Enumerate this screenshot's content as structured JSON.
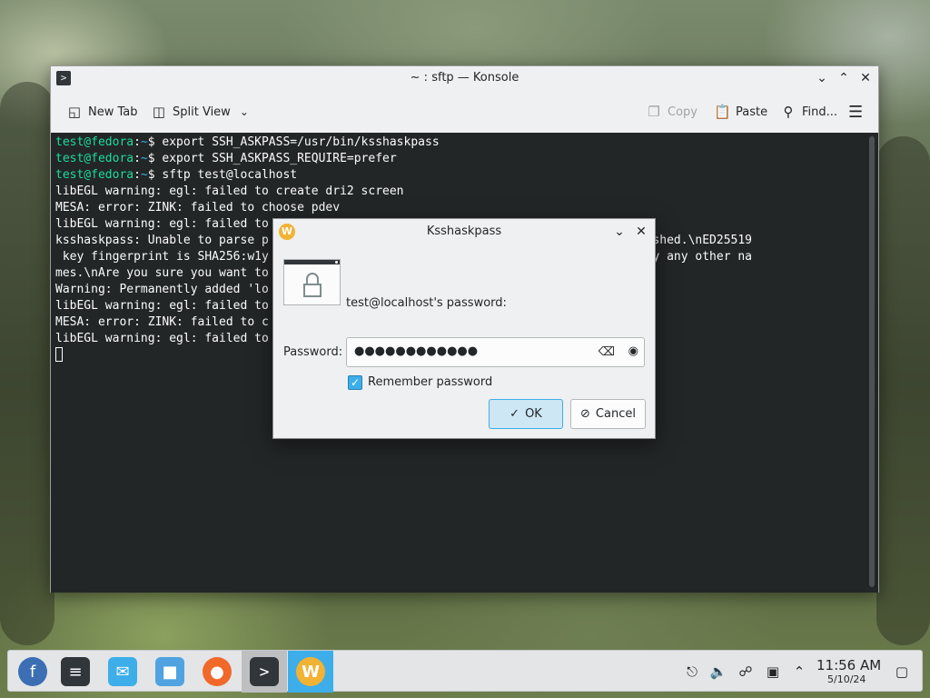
{
  "konsole": {
    "title": "~ : sftp — Konsole",
    "toolbar": {
      "new_tab": "New Tab",
      "split_view": "Split View",
      "copy": "Copy",
      "paste": "Paste",
      "find": "Find..."
    },
    "terminal_lines": [
      {
        "user": "test@fedora",
        "path": "~",
        "cmd": "$ export SSH_ASKPASS=/usr/bin/ksshaskpass"
      },
      {
        "user": "test@fedora",
        "path": "~",
        "cmd": "$ export SSH_ASKPASS_REQUIRE=prefer"
      },
      {
        "user": "test@fedora",
        "path": "~",
        "cmd": "$ sftp test@localhost"
      },
      {
        "text": "libEGL warning: egl: failed to create dri2 screen"
      },
      {
        "text": "MESA: error: ZINK: failed to choose pdev"
      },
      {
        "text": "libEGL warning: egl: failed to"
      },
      {
        "text": "ksshaskpass: Unable to parse p                                         't be established.\\nED25519"
      },
      {
        "text": " key fingerprint is SHA256:w1y                                         s not known by any other na"
      },
      {
        "text": "mes.\\nAre you sure you want to"
      },
      {
        "text": "Warning: Permanently added 'lo"
      },
      {
        "text": "libEGL warning: egl: failed to"
      },
      {
        "text": "MESA: error: ZINK: failed to c"
      },
      {
        "text": "libEGL warning: egl: failed to"
      }
    ]
  },
  "dialog": {
    "title": "Ksshaskpass",
    "prompt": "test@localhost's password:",
    "password_label": "Password:",
    "password_value": "●●●●●●●●●●●●",
    "remember_label": "Remember password",
    "remember_checked": true,
    "ok_label": "OK",
    "cancel_label": "Cancel"
  },
  "taskbar": {
    "clock_time": "11:56 AM",
    "clock_date": "5/10/24",
    "launchers": [
      "fedora-icon",
      "system-settings-icon",
      "discover-icon",
      "files-icon",
      "firefox-icon",
      "konsole-icon",
      "kwallet-icon"
    ]
  },
  "colors": {
    "accent": "#3daee9",
    "terminal_bg": "#232627",
    "prompt_user": "#1cdc9a",
    "prompt_path": "#3daee9"
  }
}
